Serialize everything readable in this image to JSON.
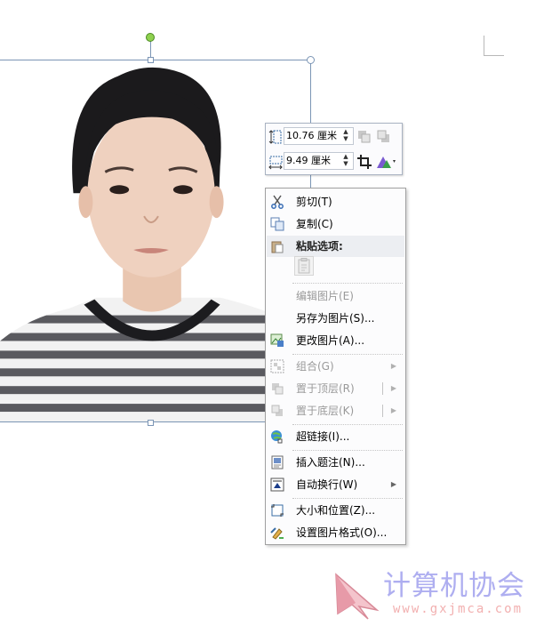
{
  "toolbar": {
    "height_value": "10.76 厘米",
    "width_value": "9.49 厘米"
  },
  "context_menu": {
    "items": [
      {
        "label": "剪切(T)"
      },
      {
        "label": "复制(C)"
      },
      {
        "label": "粘贴选项:"
      },
      {
        "label": "编辑图片(E)"
      },
      {
        "label": "另存为图片(S)..."
      },
      {
        "label": "更改图片(A)..."
      },
      {
        "label": "组合(G)"
      },
      {
        "label": "置于顶层(R)"
      },
      {
        "label": "置于底层(K)"
      },
      {
        "label": "超链接(I)..."
      },
      {
        "label": "插入题注(N)..."
      },
      {
        "label": "自动换行(W)"
      },
      {
        "label": "大小和位置(Z)..."
      },
      {
        "label": "设置图片格式(O)..."
      }
    ]
  },
  "watermark": {
    "title": "计算机协会",
    "url": "www.gxjmca.com"
  },
  "colors": {
    "selection_border": "#7b95b5",
    "rotate_handle": "#8fd14f",
    "watermark_title": "#aeaef0",
    "watermark_url": "#f2b0b0"
  }
}
